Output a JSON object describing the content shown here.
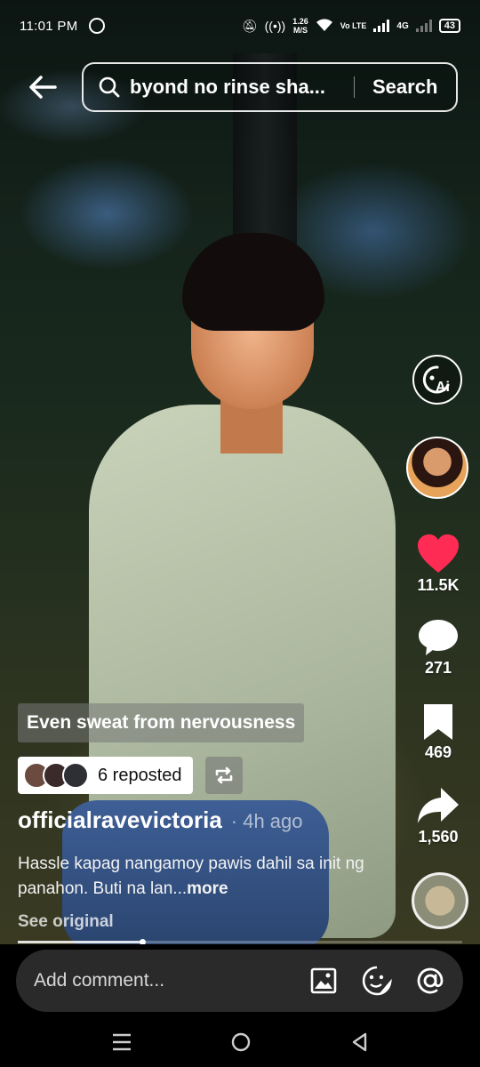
{
  "status_bar": {
    "time": "11:01 PM",
    "net_speed_value": "1.26",
    "net_speed_unit": "M/S",
    "volte_label": "Vo LTE",
    "network_type": "4G",
    "battery": "43"
  },
  "search": {
    "query": "byond no rinse sha...",
    "button_label": "Search"
  },
  "rail": {
    "ai_label": "Ai",
    "likes": "11.5K",
    "comments": "271",
    "saves": "469",
    "shares": "1,560"
  },
  "post": {
    "caption_overlay": "Even sweat from nervousness",
    "repost_text": "6 reposted",
    "author": "officialravevictoria",
    "age": "· 4h ago",
    "description": "Hassle kapag nangamoy pawis dahil sa init ng panahon. Buti na lan...",
    "more_label": "more",
    "see_original": "See original",
    "progress": 0.28
  },
  "comment_bar": {
    "placeholder": "Add comment..."
  },
  "colors": {
    "like_red": "#fe2c55",
    "comment_bg": "#2a2a2a"
  }
}
